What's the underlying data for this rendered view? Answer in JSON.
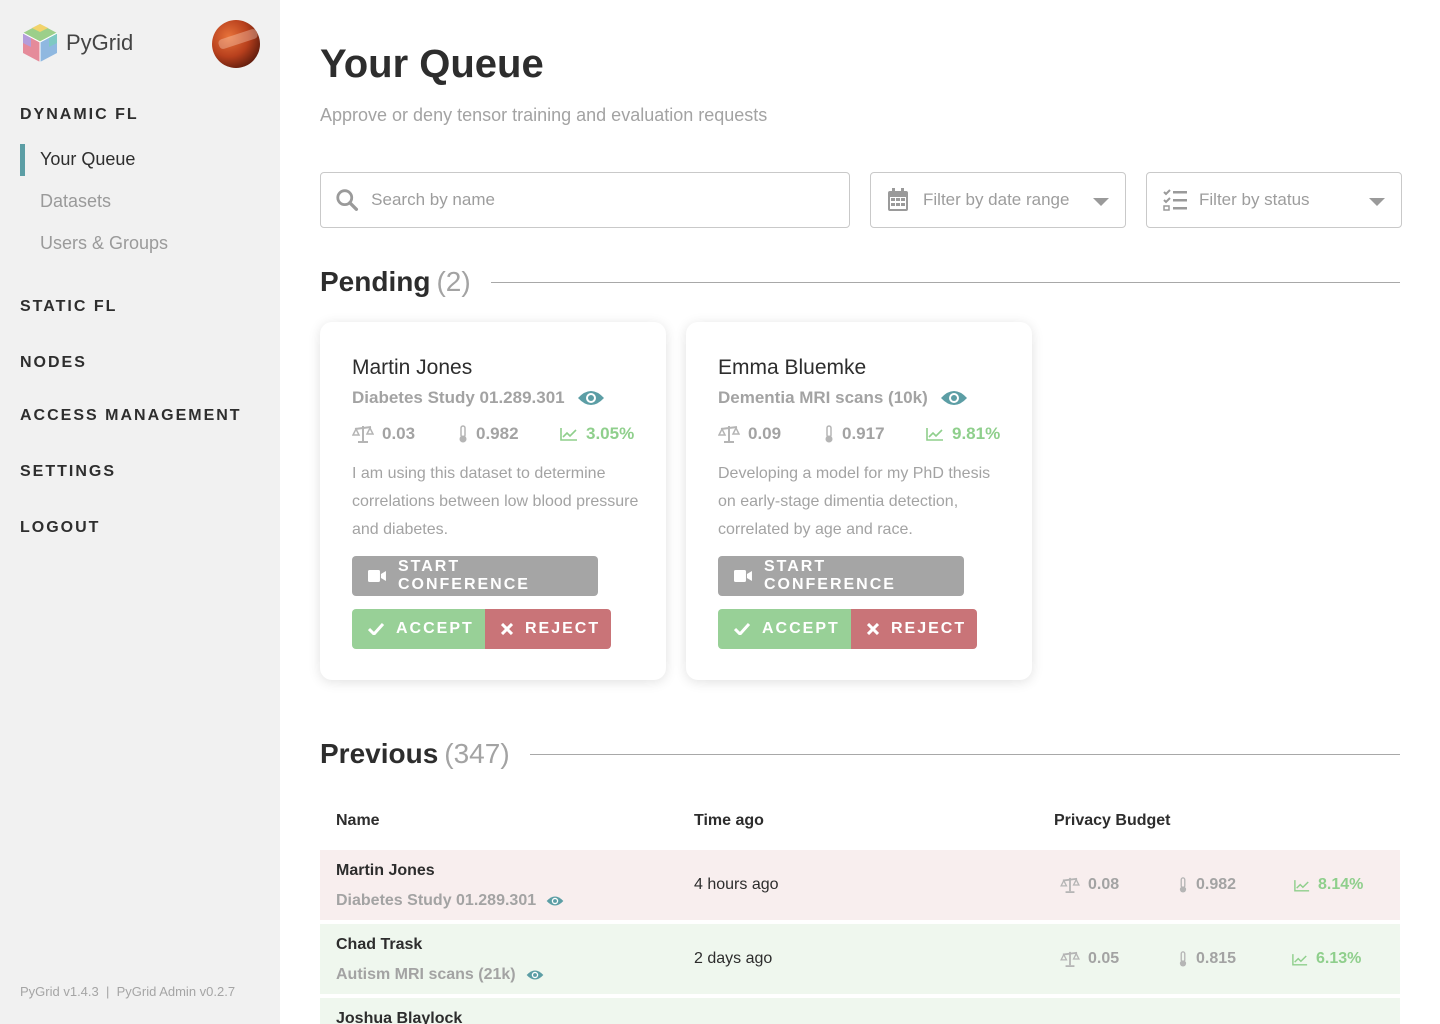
{
  "sidebar": {
    "brand": "PyGrid",
    "sections": {
      "dynamic_fl": "DYNAMIC FL",
      "static_fl": "STATIC FL",
      "nodes": "NODES",
      "access_management": "ACCESS MANAGEMENT",
      "settings": "SETTINGS",
      "logout": "LOGOUT"
    },
    "items": [
      "Your Queue",
      "Datasets",
      "Users & Groups"
    ],
    "version": "PyGrid v1.4.3  |  PyGrid Admin v0.2.7"
  },
  "page": {
    "title": "Your Queue",
    "subtitle": "Approve or deny tensor training and evaluation requests"
  },
  "filters": {
    "search_placeholder": "Search by name",
    "date_placeholder": "Filter by date range",
    "status_placeholder": "Filter by status"
  },
  "pending": {
    "title": "Pending",
    "count": "(2)",
    "cards": [
      {
        "name": "Martin Jones",
        "dataset": "Diabetes Study 01.289.301",
        "epsilon": "0.03",
        "thermo": "0.982",
        "trend": "3.05%",
        "description": "I am using this dataset to determine correlations between low blood pressure and diabetes.",
        "conference": "START CONFERENCE",
        "accept": "ACCEPT",
        "reject": "REJECT"
      },
      {
        "name": "Emma Bluemke",
        "dataset": "Dementia MRI scans (10k)",
        "epsilon": "0.09",
        "thermo": "0.917",
        "trend": "9.81%",
        "description": "Developing a model for my PhD thesis on early-stage dimentia detection, correlated by age and race.",
        "conference": "START CONFERENCE",
        "accept": "ACCEPT",
        "reject": "REJECT"
      }
    ]
  },
  "previous": {
    "title": "Previous",
    "count": "(347)",
    "columns": [
      "Name",
      "Time ago",
      "Privacy Budget"
    ],
    "rows": [
      {
        "name": "Martin Jones",
        "dataset": "Diabetes Study 01.289.301",
        "time": "4 hours ago",
        "epsilon": "0.08",
        "thermo": "0.982",
        "trend": "8.14%",
        "status": "rejected"
      },
      {
        "name": "Chad Trask",
        "dataset": "Autism MRI scans (21k)",
        "time": "2 days ago",
        "epsilon": "0.05",
        "thermo": "0.815",
        "trend": "6.13%",
        "status": "accepted"
      },
      {
        "name": "Joshua Blaylock",
        "dataset": "",
        "time": "",
        "epsilon": "",
        "thermo": "",
        "trend": "",
        "status": "accepted"
      }
    ]
  },
  "colors": {
    "accent": "#5c9ea5",
    "accept": "#98d097",
    "reject": "#c97478",
    "conference": "#a5a5a5",
    "trend": "#8fcf8c"
  }
}
